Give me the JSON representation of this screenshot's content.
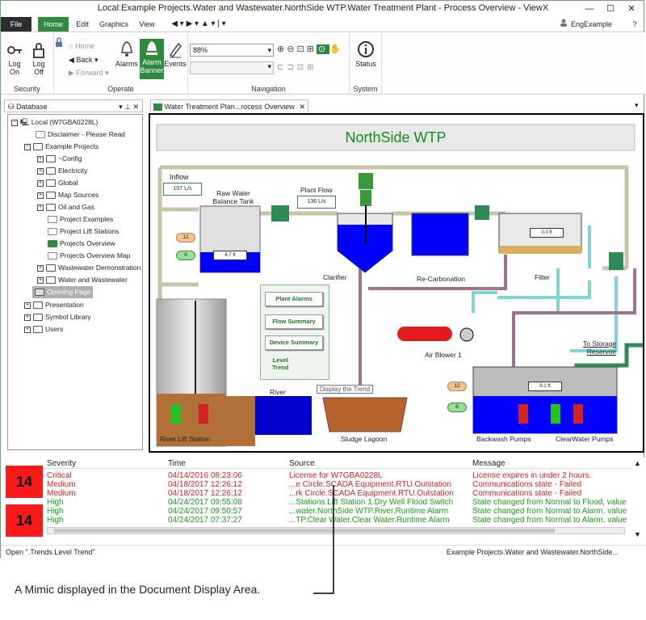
{
  "window": {
    "title": "Local:Example Projects.Water and Wastewater.NorthSide WTP.Water Treatment Plant - Process Overview - ViewX",
    "controls": [
      "—",
      "☐",
      "✕"
    ]
  },
  "menu_tabs": [
    "File",
    "Home",
    "Edit",
    "Graphics",
    "View"
  ],
  "user": "EngExample",
  "ribbon": {
    "security": {
      "label": "Security",
      "log_on": "Log On",
      "log_off": "Log Off"
    },
    "operate": {
      "label": "Operate",
      "home": "Home",
      "back": "Back",
      "forward": "Forward",
      "alarms": "Alarms",
      "alarm_banner": "Alarm Banner",
      "events": "Events"
    },
    "navigation": {
      "label": "Navigation",
      "zoom": "88%"
    },
    "system": {
      "label": "System",
      "status": "Status"
    }
  },
  "database_pane": {
    "title": "Database",
    "tree": [
      "Local (W7GBA0228L)",
      "Disclaimer - Please Read",
      "Example Projects",
      "~Config",
      "Electricity",
      "Global",
      "Map Sources",
      "Oil and Gas",
      "Project Examples",
      "Project Lift Stations",
      "Projects Overview",
      "Projects Overview Map",
      "Wastewater Demonstration",
      "Water and Wastewater",
      "Opening Page",
      "Presentation",
      "Symbol Library",
      "Users"
    ]
  },
  "document_tab": "Water Treatment Plan...rocess Overview",
  "mimic": {
    "title": "NorthSide WTP",
    "inflow_label": "Inflow",
    "inflow_value": "107 L/s",
    "plant_flow_label": "Plant Flow",
    "plant_flow_value": "136 L/s",
    "raw_tank_label": "Raw Water\nBalance Tank",
    "raw_tank_level": "6.7 ft",
    "setpoint_12": "12",
    "setpoint_6": "6",
    "clarifier": "Clarifier",
    "recarbonation": "Re-Carbonation",
    "filter": "Filter",
    "filter_level": "0.0 ft",
    "air_blower": "Air Blower 1",
    "to_storage": "To Storage\nReservoir",
    "clearwell_level": "9.1 ft",
    "backwash": "Backwash Pumps",
    "clearwater": "ClearWater Pumps",
    "river": "River",
    "river_lift": "River Lift Station",
    "sludge": "Sludge Lagoon",
    "tooltip": "Display the Trend",
    "buttons": [
      "Plant Alarms",
      "Flow Summary",
      "Device Summary"
    ],
    "level_trend": "Level\nTrend"
  },
  "alarm_banner": {
    "columns": [
      "Severity",
      "Time",
      "Source",
      "Message"
    ],
    "counts": [
      "14",
      "14"
    ],
    "rows": [
      {
        "severity": "Critical",
        "time": "04/14/2016 08:23:06",
        "source": "License for W7GBA0228L",
        "message": "License expires in under 2 hours.",
        "color": "#e02020"
      },
      {
        "severity": "Medium",
        "time": "04/18/2017 12:26:12",
        "source": "...e Circle.SCADA Equipment.RTU.Outstation",
        "message": "Communications state - Failed",
        "color": "#e02020"
      },
      {
        "severity": "Medium",
        "time": "04/18/2017 12:26:12",
        "source": "...rk Circle.SCADA Equipment.RTU.Outstation",
        "message": "Communications state - Failed",
        "color": "#e02020"
      },
      {
        "severity": "High",
        "time": "04/24/2017 09:55:08",
        "source": "...Stations.Lift Station 1.Dry Well Flood Switch",
        "message": "State changed from Normal to Flood, value",
        "color": "#18a018"
      },
      {
        "severity": "High",
        "time": "04/24/2017 09:50:57",
        "source": "...water.NorthSide WTP.River.Runtime Alarm",
        "message": "State changed from Normal to Alarm, value",
        "color": "#18a018"
      },
      {
        "severity": "High",
        "time": "04/24/2017 07:37:27",
        "source": "...TP.Clear Water.Clear Water.Runtime Alarm",
        "message": "State changed from Normal to Alarm, value",
        "color": "#18a018"
      }
    ]
  },
  "status_bar": {
    "left": "Open \".Trends.Level Trend\"",
    "right": "Example Projects.Water and Wastewater.NorthSide..."
  },
  "caption": "A Mimic displayed in the Document Display Area."
}
